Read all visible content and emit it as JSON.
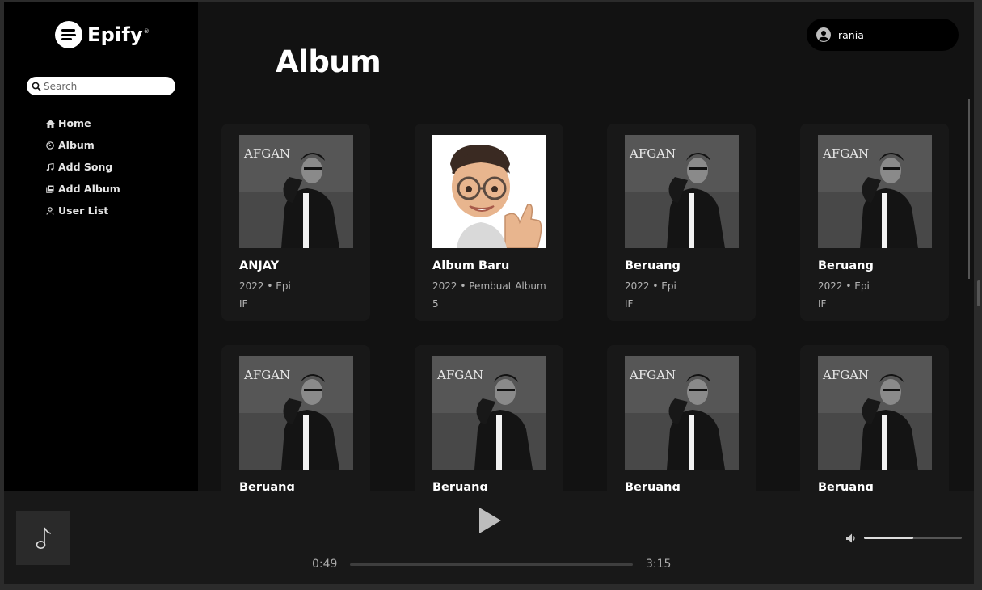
{
  "app": {
    "name": "Epify",
    "registered_mark": "®",
    "brand_color": "#ffffff",
    "background": "#121212",
    "sidebar_background": "#000000"
  },
  "search": {
    "placeholder": "Search",
    "value": ""
  },
  "nav": [
    {
      "label": "Home",
      "icon": "home-icon"
    },
    {
      "label": "Album",
      "icon": "album-icon"
    },
    {
      "label": "Add Song",
      "icon": "music-note-icon"
    },
    {
      "label": "Add Album",
      "icon": "add-album-icon"
    },
    {
      "label": "User List",
      "icon": "user-icon"
    }
  ],
  "user": {
    "name": "rania",
    "icon": "user-avatar-icon"
  },
  "page": {
    "title": "Album"
  },
  "albums": [
    {
      "title": "ANJAY",
      "subtitle": "2022 • Epi",
      "extra": "IF",
      "cover": "afgan-photo"
    },
    {
      "title": "Album Baru",
      "subtitle": "2022 • Pembuat Album",
      "extra": "5",
      "cover": "memoji-thumbs-up"
    },
    {
      "title": "Beruang",
      "subtitle": "2022 • Epi",
      "extra": "IF",
      "cover": "afgan-photo"
    },
    {
      "title": "Beruang",
      "subtitle": "2022 • Epi",
      "extra": "IF",
      "cover": "afgan-photo"
    },
    {
      "title": "Beruang",
      "subtitle": "",
      "extra": "",
      "cover": "afgan-photo"
    },
    {
      "title": "Beruang",
      "subtitle": "",
      "extra": "",
      "cover": "afgan-photo"
    },
    {
      "title": "Beruang",
      "subtitle": "",
      "extra": "",
      "cover": "afgan-photo"
    },
    {
      "title": "Beruang",
      "subtitle": "",
      "extra": "",
      "cover": "afgan-photo"
    }
  ],
  "cover_logo_text": "AFGAN",
  "player": {
    "current_time": "0:49",
    "duration": "3:15",
    "progress": 0,
    "volume": 0.5,
    "placeholder_icon": "music-note-icon",
    "play_icon": "play-icon",
    "volume_icon": "volume-icon"
  }
}
